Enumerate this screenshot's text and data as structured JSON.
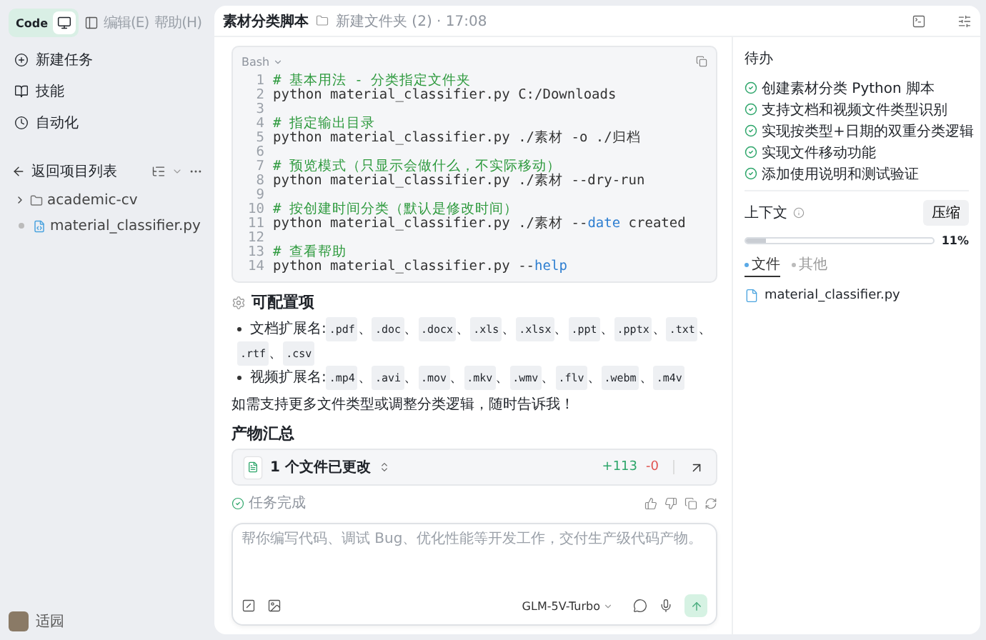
{
  "sidebar": {
    "mode_tabs": [
      {
        "label": "Code",
        "kind": "text",
        "selected": true
      },
      {
        "kind": "icon",
        "selected": false
      }
    ],
    "menu": [
      {
        "label": "编辑(E)",
        "disabled": true
      },
      {
        "label": "帮助(H)",
        "disabled": true
      }
    ],
    "nav_items": [
      {
        "label": "新建任务",
        "kind": "new"
      },
      {
        "label": "技能",
        "kind": "skill"
      },
      {
        "label": "自动化",
        "kind": "auto"
      }
    ],
    "back": {
      "label": "返回项目列表"
    },
    "tree": [
      {
        "label": "academic-cv",
        "kind": "folder",
        "expanded": false
      },
      {
        "label": "material_classifier.py",
        "kind": "file"
      }
    ],
    "user": {
      "name": "适园"
    }
  },
  "header": {
    "title": "素材分类脚本",
    "folder": "新建文件夹 (2) · 17:08"
  },
  "code_block": {
    "language": "Bash",
    "lines": [
      {
        "number": "1",
        "segments": [
          {
            "t": "# 基本用法 - 分类指定文件夹",
            "kind": "comment"
          }
        ]
      },
      {
        "number": "2",
        "segments": [
          {
            "t": "python material_classifier.py C:/Downloads",
            "kind": "plain"
          }
        ]
      },
      {
        "number": "3"
      },
      {
        "number": "4",
        "segments": [
          {
            "t": "# 指定输出目录",
            "kind": "comment"
          }
        ]
      },
      {
        "number": "5",
        "segments": [
          {
            "t": "python material_classifier.py ./素材 -o ./归档",
            "kind": "plain"
          }
        ]
      },
      {
        "number": "6"
      },
      {
        "number": "7",
        "segments": [
          {
            "t": "# 预览模式（只显示会做什么，不实际移动）",
            "kind": "comment"
          }
        ]
      },
      {
        "number": "8",
        "segments": [
          {
            "t": "python material_classifier.py ./素材 --dry-run",
            "kind": "plain"
          }
        ]
      },
      {
        "number": "9"
      },
      {
        "number": "10",
        "segments": [
          {
            "t": "# 按创建时间分类（默认是修改时间）",
            "kind": "comment"
          }
        ]
      },
      {
        "number": "11",
        "segments": [
          {
            "t": "python material_classifier.py ./素材 --",
            "kind": "plain"
          },
          {
            "t": "date",
            "kind": "keyword"
          },
          {
            "t": " created",
            "kind": "plain"
          }
        ]
      },
      {
        "number": "12"
      },
      {
        "number": "13",
        "segments": [
          {
            "t": "# 查看帮助",
            "kind": "comment"
          }
        ]
      },
      {
        "number": "14",
        "segments": [
          {
            "t": "python material_classifier.py --",
            "kind": "plain"
          },
          {
            "t": "help",
            "kind": "keyword"
          }
        ]
      }
    ]
  },
  "config": {
    "title": "可配置项",
    "separator": "、",
    "bullets": [
      {
        "label": "文档扩展名:",
        "exts": [
          ".pdf",
          ".doc",
          ".docx",
          ".xls",
          ".xlsx",
          ".ppt",
          ".pptx",
          ".txt",
          ".rtf",
          ".csv"
        ]
      },
      {
        "label": "视频扩展名:",
        "exts": [
          ".mp4",
          ".avi",
          ".mov",
          ".mkv",
          ".wmv",
          ".flv",
          ".webm",
          ".m4v"
        ]
      }
    ],
    "note": "如需支持更多文件类型或调整分类逻辑，随时告诉我！"
  },
  "artifacts": {
    "title": "产物汇总",
    "changes": "1 个文件已更改",
    "added": "+113",
    "removed": "-0"
  },
  "status": "任务完成",
  "composer": {
    "placeholder": "帮你编写代码、调试 Bug、优化性能等开发工作，交付生产级代码产物。",
    "model": "GLM-5V-Turbo"
  },
  "todo": {
    "title": "待办",
    "items": [
      {
        "label": "创建素材分类 Python 脚本",
        "checked": true
      },
      {
        "label": "支持文档和视频文件类型识别",
        "checked": true
      },
      {
        "label": "实现按类型+日期的双重分类逻辑",
        "checked": true
      },
      {
        "label": "实现文件移动功能",
        "checked": true
      },
      {
        "label": "添加使用说明和测试验证",
        "checked": true
      }
    ]
  },
  "context": {
    "title": "上下文",
    "compress": "压缩",
    "level": 0.11,
    "reading": "11%",
    "tabs": [
      {
        "label": "文件",
        "selected": true
      },
      {
        "label": "其他",
        "selected": false
      }
    ],
    "files": [
      "material_classifier.py"
    ]
  }
}
